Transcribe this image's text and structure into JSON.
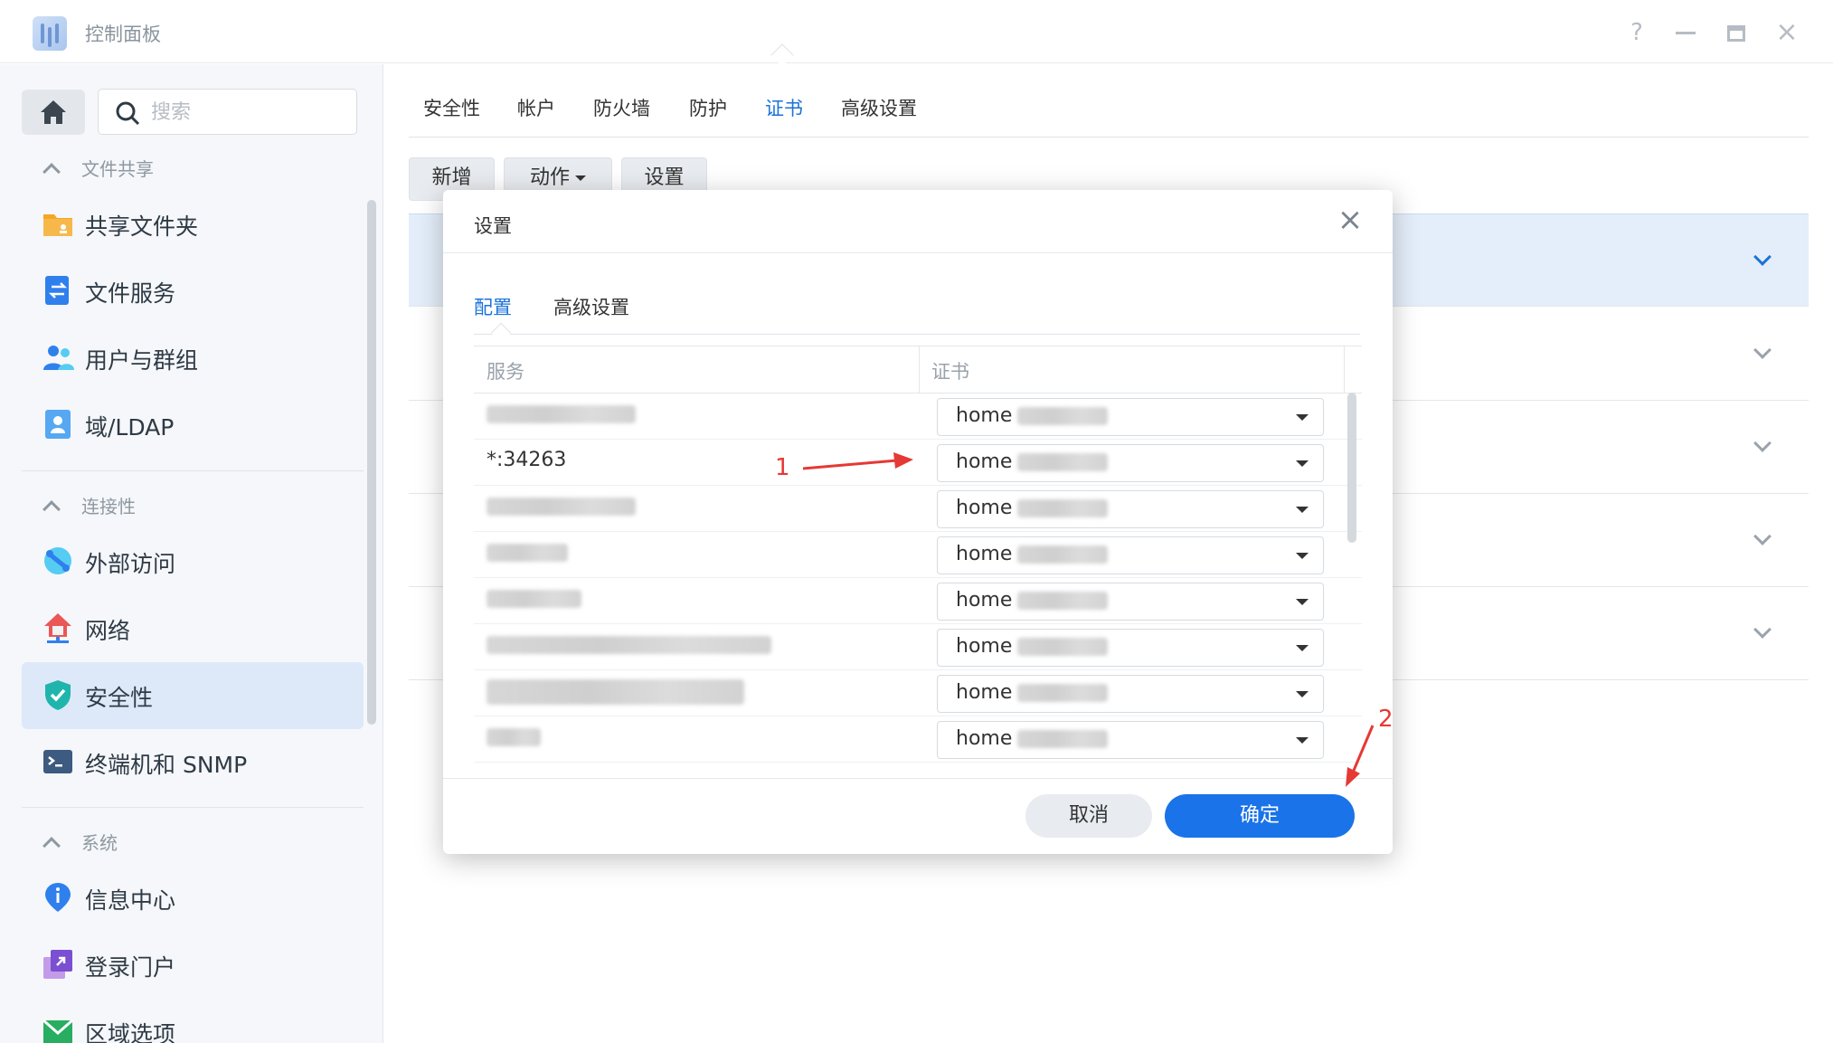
{
  "window": {
    "title": "控制面板",
    "help_label": "?",
    "close_label": "×"
  },
  "sidebar": {
    "search_placeholder": "搜索",
    "sections": [
      {
        "label": "文件共享"
      },
      {
        "label": "连接性"
      },
      {
        "label": "系统"
      }
    ],
    "items": [
      {
        "label": "共享文件夹",
        "icon": "folder-icon"
      },
      {
        "label": "文件服务",
        "icon": "file-services-icon"
      },
      {
        "label": "用户与群组",
        "icon": "users-icon"
      },
      {
        "label": "域/LDAP",
        "icon": "ldap-icon"
      },
      {
        "label": "外部访问",
        "icon": "external-access-icon"
      },
      {
        "label": "网络",
        "icon": "network-icon"
      },
      {
        "label": "安全性",
        "icon": "shield-icon",
        "active": true
      },
      {
        "label": "终端机和 SNMP",
        "icon": "terminal-icon"
      },
      {
        "label": "信息中心",
        "icon": "info-icon"
      },
      {
        "label": "登录门户",
        "icon": "login-portal-icon"
      },
      {
        "label": "区域选项",
        "icon": "regional-options-icon"
      }
    ]
  },
  "main": {
    "tabs": [
      {
        "label": "安全性"
      },
      {
        "label": "帐户"
      },
      {
        "label": "防火墙"
      },
      {
        "label": "防护"
      },
      {
        "label": "证书",
        "active": true
      },
      {
        "label": "高级设置"
      }
    ],
    "toolbar": {
      "add_label": "新增",
      "action_label": "动作",
      "settings_label": "设置"
    }
  },
  "dialog": {
    "title": "设置",
    "close_label": "×",
    "tabs": [
      {
        "label": "配置",
        "active": true
      },
      {
        "label": "高级设置"
      }
    ],
    "table": {
      "col_service": "服务",
      "col_cert": "证书",
      "rows": [
        {
          "service": "",
          "cert": "home"
        },
        {
          "service": "*:34263",
          "cert": "home"
        },
        {
          "service": "",
          "cert": "home"
        },
        {
          "service": "",
          "cert": "home"
        },
        {
          "service": "",
          "cert": "home"
        },
        {
          "service": "",
          "cert": "home"
        },
        {
          "service": "",
          "cert": "home"
        },
        {
          "service": "",
          "cert": "home"
        }
      ]
    },
    "cancel_label": "取消",
    "ok_label": "确定"
  },
  "annotations": {
    "arrow1_label": "1",
    "arrow2_label": "2"
  },
  "colors": {
    "accent": "#1a73e8",
    "annotation": "#e53935",
    "active_nav_bg": "#dde9f8"
  }
}
